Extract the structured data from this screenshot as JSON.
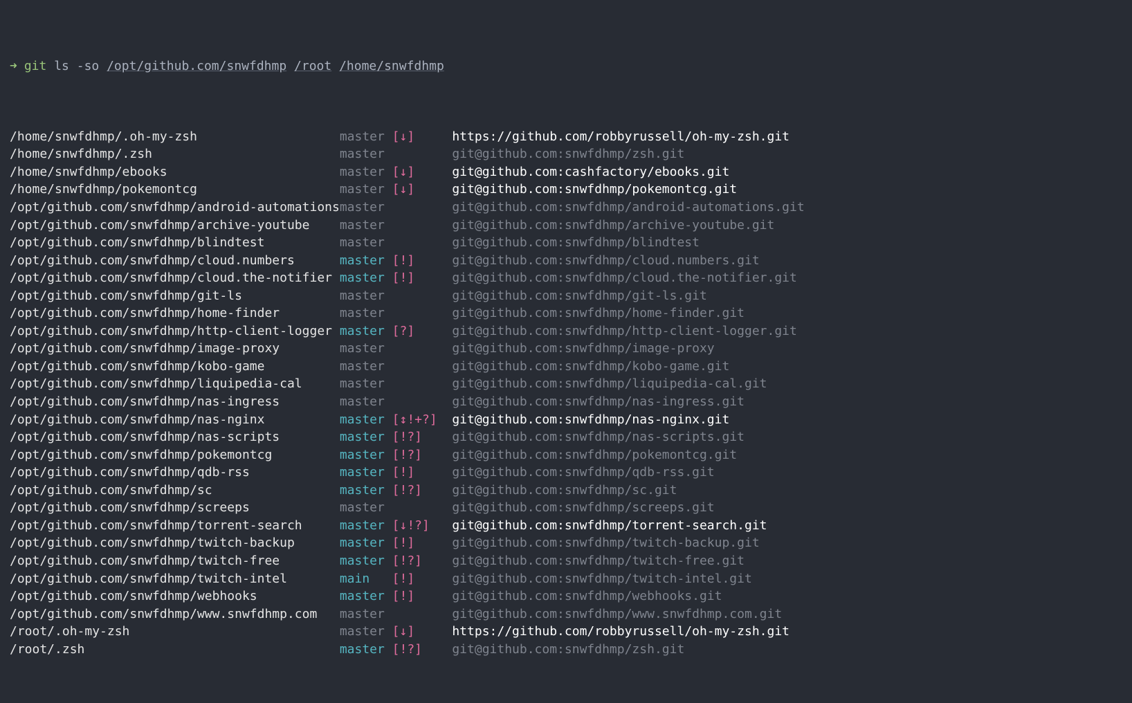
{
  "prompt": {
    "arrow": "➜",
    "cmd": "git",
    "sub": "ls",
    "flags": "-so",
    "args": [
      "/opt/github.com/snwfdhmp",
      "/root",
      "/home/snwfdhmp"
    ]
  },
  "rows": [
    {
      "path": "/home/snwfdhmp/.oh-my-zsh",
      "branch": "master",
      "branch_tone": "dim",
      "status": "[↓]",
      "remote": "https://github.com/robbyrussell/oh-my-zsh.git",
      "remote_tone": "bright"
    },
    {
      "path": "/home/snwfdhmp/.zsh",
      "branch": "master",
      "branch_tone": "dim",
      "status": "",
      "remote": "git@github.com:snwfdhmp/zsh.git",
      "remote_tone": "dim"
    },
    {
      "path": "/home/snwfdhmp/ebooks",
      "branch": "master",
      "branch_tone": "dim",
      "status": "[↓]",
      "remote": "git@github.com:cashfactory/ebooks.git",
      "remote_tone": "bright"
    },
    {
      "path": "/home/snwfdhmp/pokemontcg",
      "branch": "master",
      "branch_tone": "dim",
      "status": "[↓]",
      "remote": "git@github.com:snwfdhmp/pokemontcg.git",
      "remote_tone": "bright"
    },
    {
      "path": "/opt/github.com/snwfdhmp/android-automations",
      "branch": "master",
      "branch_tone": "dim",
      "status": "",
      "remote": "git@github.com:snwfdhmp/android-automations.git",
      "remote_tone": "dim"
    },
    {
      "path": "/opt/github.com/snwfdhmp/archive-youtube",
      "branch": "master",
      "branch_tone": "dim",
      "status": "",
      "remote": "git@github.com:snwfdhmp/archive-youtube.git",
      "remote_tone": "dim"
    },
    {
      "path": "/opt/github.com/snwfdhmp/blindtest",
      "branch": "master",
      "branch_tone": "dim",
      "status": "",
      "remote": "git@github.com:snwfdhmp/blindtest",
      "remote_tone": "dim"
    },
    {
      "path": "/opt/github.com/snwfdhmp/cloud.numbers",
      "branch": "master",
      "branch_tone": "teal",
      "status": "[!]",
      "remote": "git@github.com:snwfdhmp/cloud.numbers.git",
      "remote_tone": "dim"
    },
    {
      "path": "/opt/github.com/snwfdhmp/cloud.the-notifier",
      "branch": "master",
      "branch_tone": "teal",
      "status": "[!]",
      "remote": "git@github.com:snwfdhmp/cloud.the-notifier.git",
      "remote_tone": "dim"
    },
    {
      "path": "/opt/github.com/snwfdhmp/git-ls",
      "branch": "master",
      "branch_tone": "dim",
      "status": "",
      "remote": "git@github.com:snwfdhmp/git-ls.git",
      "remote_tone": "dim"
    },
    {
      "path": "/opt/github.com/snwfdhmp/home-finder",
      "branch": "master",
      "branch_tone": "dim",
      "status": "",
      "remote": "git@github.com:snwfdhmp/home-finder.git",
      "remote_tone": "dim"
    },
    {
      "path": "/opt/github.com/snwfdhmp/http-client-logger",
      "branch": "master",
      "branch_tone": "teal",
      "status": "[?]",
      "remote": "git@github.com:snwfdhmp/http-client-logger.git",
      "remote_tone": "dim"
    },
    {
      "path": "/opt/github.com/snwfdhmp/image-proxy",
      "branch": "master",
      "branch_tone": "dim",
      "status": "",
      "remote": "git@github.com:snwfdhmp/image-proxy",
      "remote_tone": "dim"
    },
    {
      "path": "/opt/github.com/snwfdhmp/kobo-game",
      "branch": "master",
      "branch_tone": "dim",
      "status": "",
      "remote": "git@github.com:snwfdhmp/kobo-game.git",
      "remote_tone": "dim"
    },
    {
      "path": "/opt/github.com/snwfdhmp/liquipedia-cal",
      "branch": "master",
      "branch_tone": "dim",
      "status": "",
      "remote": "git@github.com:snwfdhmp/liquipedia-cal.git",
      "remote_tone": "dim"
    },
    {
      "path": "/opt/github.com/snwfdhmp/nas-ingress",
      "branch": "master",
      "branch_tone": "dim",
      "status": "",
      "remote": "git@github.com:snwfdhmp/nas-ingress.git",
      "remote_tone": "dim"
    },
    {
      "path": "/opt/github.com/snwfdhmp/nas-nginx",
      "branch": "master",
      "branch_tone": "teal",
      "status": "[↕!+?]",
      "remote": "git@github.com:snwfdhmp/nas-nginx.git",
      "remote_tone": "bright"
    },
    {
      "path": "/opt/github.com/snwfdhmp/nas-scripts",
      "branch": "master",
      "branch_tone": "teal",
      "status": "[!?]",
      "remote": "git@github.com:snwfdhmp/nas-scripts.git",
      "remote_tone": "dim"
    },
    {
      "path": "/opt/github.com/snwfdhmp/pokemontcg",
      "branch": "master",
      "branch_tone": "teal",
      "status": "[!?]",
      "remote": "git@github.com:snwfdhmp/pokemontcg.git",
      "remote_tone": "dim"
    },
    {
      "path": "/opt/github.com/snwfdhmp/qdb-rss",
      "branch": "master",
      "branch_tone": "teal",
      "status": "[!]",
      "remote": "git@github.com:snwfdhmp/qdb-rss.git",
      "remote_tone": "dim"
    },
    {
      "path": "/opt/github.com/snwfdhmp/sc",
      "branch": "master",
      "branch_tone": "teal",
      "status": "[!?]",
      "remote": "git@github.com:snwfdhmp/sc.git",
      "remote_tone": "dim"
    },
    {
      "path": "/opt/github.com/snwfdhmp/screeps",
      "branch": "master",
      "branch_tone": "dim",
      "status": "",
      "remote": "git@github.com:snwfdhmp/screeps.git",
      "remote_tone": "dim"
    },
    {
      "path": "/opt/github.com/snwfdhmp/torrent-search",
      "branch": "master",
      "branch_tone": "teal",
      "status": "[↓!?]",
      "remote": "git@github.com:snwfdhmp/torrent-search.git",
      "remote_tone": "bright"
    },
    {
      "path": "/opt/github.com/snwfdhmp/twitch-backup",
      "branch": "master",
      "branch_tone": "teal",
      "status": "[!]",
      "remote": "git@github.com:snwfdhmp/twitch-backup.git",
      "remote_tone": "dim"
    },
    {
      "path": "/opt/github.com/snwfdhmp/twitch-free",
      "branch": "master",
      "branch_tone": "teal",
      "status": "[!?]",
      "remote": "git@github.com:snwfdhmp/twitch-free.git",
      "remote_tone": "dim"
    },
    {
      "path": "/opt/github.com/snwfdhmp/twitch-intel",
      "branch": "main",
      "branch_tone": "teal",
      "status": "[!]",
      "remote": "git@github.com:snwfdhmp/twitch-intel.git",
      "remote_tone": "dim"
    },
    {
      "path": "/opt/github.com/snwfdhmp/webhooks",
      "branch": "master",
      "branch_tone": "teal",
      "status": "[!]",
      "remote": "git@github.com:snwfdhmp/webhooks.git",
      "remote_tone": "dim"
    },
    {
      "path": "/opt/github.com/snwfdhmp/www.snwfdhmp.com",
      "branch": "master",
      "branch_tone": "dim",
      "status": "",
      "remote": "git@github.com:snwfdhmp/www.snwfdhmp.com.git",
      "remote_tone": "dim"
    },
    {
      "path": "/root/.oh-my-zsh",
      "branch": "master",
      "branch_tone": "dim",
      "status": "[↓]",
      "remote": "https://github.com/robbyrussell/oh-my-zsh.git",
      "remote_tone": "bright"
    },
    {
      "path": "/root/.zsh",
      "branch": "master",
      "branch_tone": "teal",
      "status": "[!?]",
      "remote": "git@github.com:snwfdhmp/zsh.git",
      "remote_tone": "dim"
    }
  ]
}
